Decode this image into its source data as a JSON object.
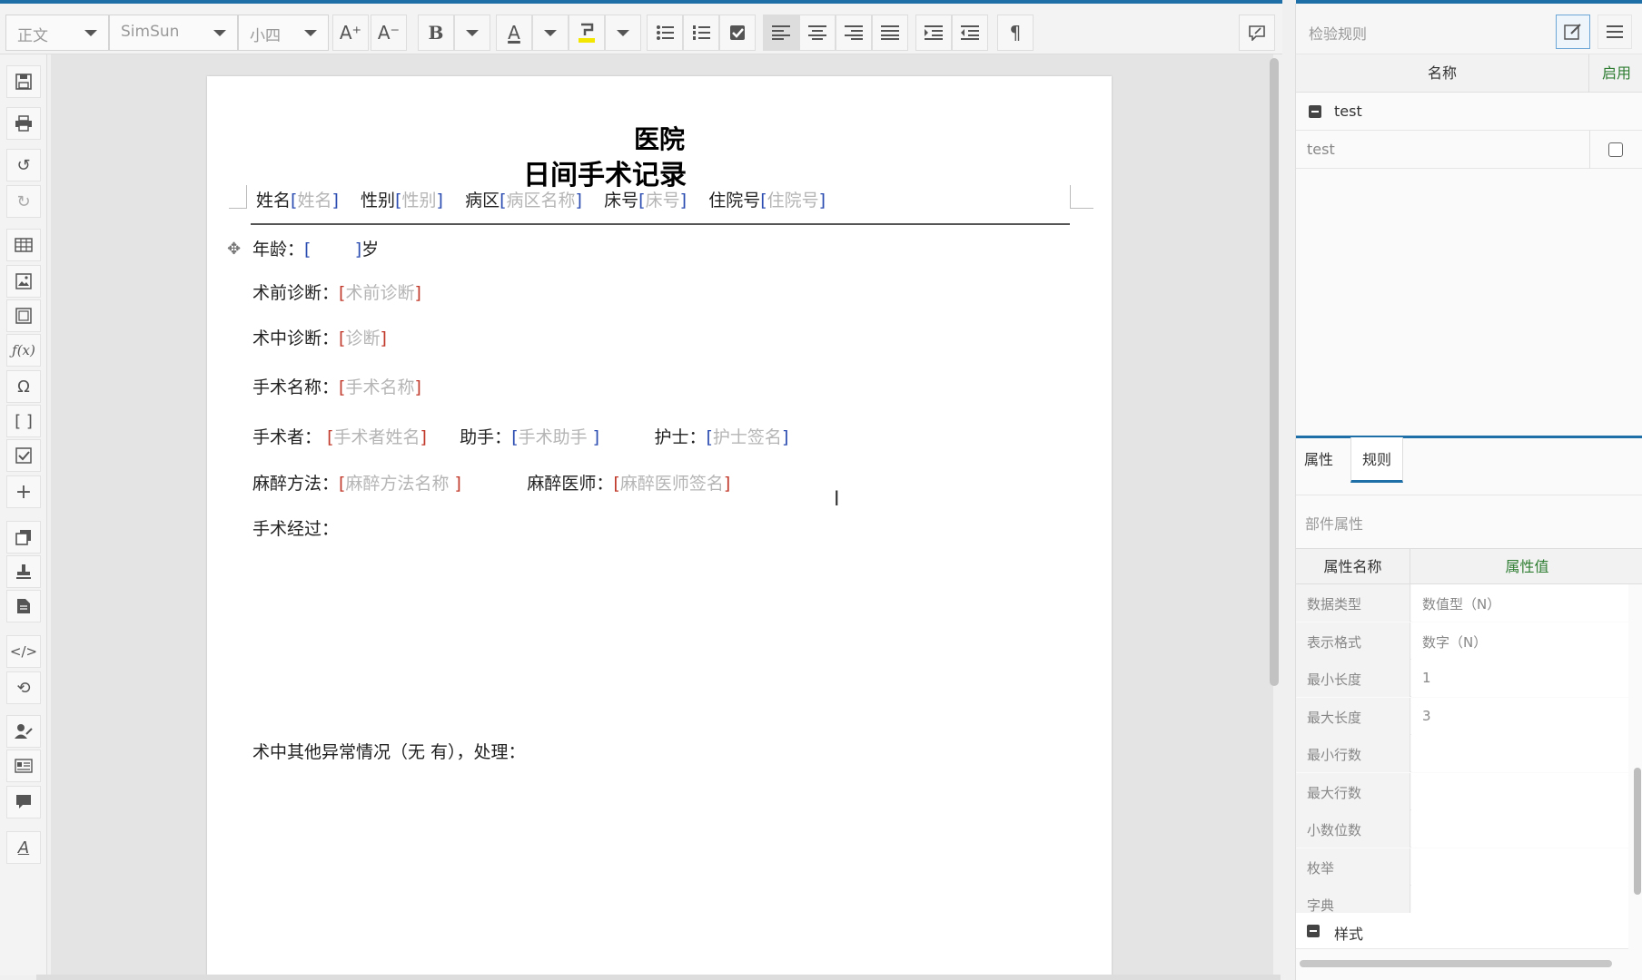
{
  "toolbar": {
    "style_select": "正文",
    "font_select": "SimSun",
    "size_select": "小四",
    "font_grow": "A⁺",
    "font_shrink": "A⁻",
    "bold": "B",
    "font_color": "A",
    "paragraph_mark": "¶"
  },
  "document": {
    "title_line1": "医院",
    "title_line2": "日间手术记录",
    "header_fields": [
      {
        "label": "姓名",
        "placeholder": "姓名"
      },
      {
        "label": "性别",
        "placeholder": "性别"
      },
      {
        "label": "病区",
        "placeholder": "病区名称"
      },
      {
        "label": "床号",
        "placeholder": "床号"
      },
      {
        "label": "住院号",
        "placeholder": "住院号"
      }
    ],
    "age_label": "年龄：",
    "age_suffix": "岁",
    "pre_diag_label": "术前诊断：",
    "pre_diag_ph": "术前诊断",
    "intra_diag_label": "术中诊断：",
    "intra_diag_ph": "诊断",
    "op_name_label": "手术名称：",
    "op_name_ph": "手术名称",
    "surgeon_label": "手术者：",
    "surgeon_ph": "手术者姓名",
    "assistant_label": "助手：",
    "assistant_ph": "手术助手 ",
    "nurse_label": "护士：",
    "nurse_ph": "护士签名",
    "anes_method_label": "麻醉方法：",
    "anes_method_ph": "麻醉方法名称 ",
    "anes_doctor_label": "麻醉医师：",
    "anes_doctor_ph": "麻醉医师签名",
    "process_label": "手术经过：",
    "other_label": "术中其他异常情况（无  有），处理："
  },
  "right_panel": {
    "title": "检验规则",
    "col_name": "名称",
    "col_enable": "启用",
    "group_name": "test",
    "item_name": "test",
    "tab_props": "属性",
    "tab_rules": "规则",
    "section_title": "部件属性",
    "prop_col_name": "属性名称",
    "prop_col_value": "属性值",
    "properties": [
      {
        "name": "数据类型",
        "value": "数值型（N）"
      },
      {
        "name": "表示格式",
        "value": "数字（N）"
      },
      {
        "name": "最小长度",
        "value": "1"
      },
      {
        "name": "最大长度",
        "value": "3"
      },
      {
        "name": "最小行数",
        "value": ""
      },
      {
        "name": "最大行数",
        "value": ""
      },
      {
        "name": "小数位数",
        "value": ""
      },
      {
        "name": "枚举",
        "value": ""
      },
      {
        "name": "字典",
        "value": ""
      }
    ],
    "style_group": "样式"
  }
}
